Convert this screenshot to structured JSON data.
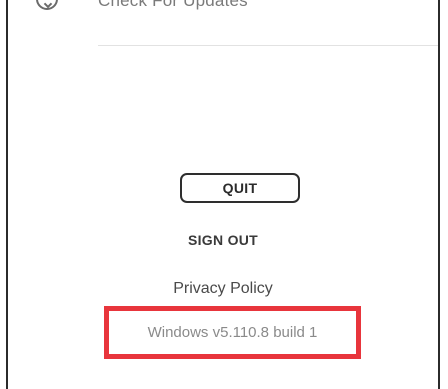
{
  "menu": {
    "check_updates_label": "Check For Updates",
    "check_updates_icon": "refresh-icon"
  },
  "actions": {
    "quit_label": "QUIT",
    "sign_out_label": "SIGN OUT",
    "privacy_label": "Privacy Policy"
  },
  "version": {
    "text": "Windows v5.110.8 build 1"
  },
  "colors": {
    "highlight": "#e8353c",
    "border": "#2e2e2e",
    "muted_text": "#8a8a8a"
  }
}
